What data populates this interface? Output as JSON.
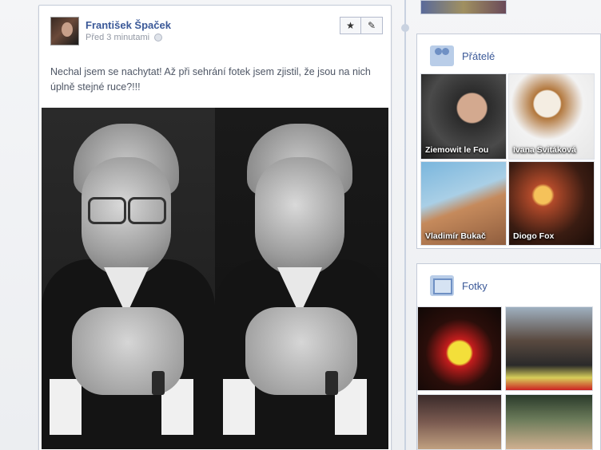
{
  "post": {
    "author": "František Špaček",
    "timestamp": "Před 3 minutami",
    "text": "Nechal jsem se nachytat! Až při sehrání fotek jsem zjistil, že jsou na nich úplně stejné ruce?!!!",
    "actions": {
      "star_icon": "★",
      "edit_icon": "✎"
    }
  },
  "sidebar": {
    "friends": {
      "title": "Přátelé",
      "items": [
        {
          "name": "Ziemowit le Fou"
        },
        {
          "name": "Ivana Svitáková"
        },
        {
          "name": "Vladimír Bukač"
        },
        {
          "name": "Diogo Fox"
        }
      ]
    },
    "photos": {
      "title": "Fotky"
    }
  }
}
